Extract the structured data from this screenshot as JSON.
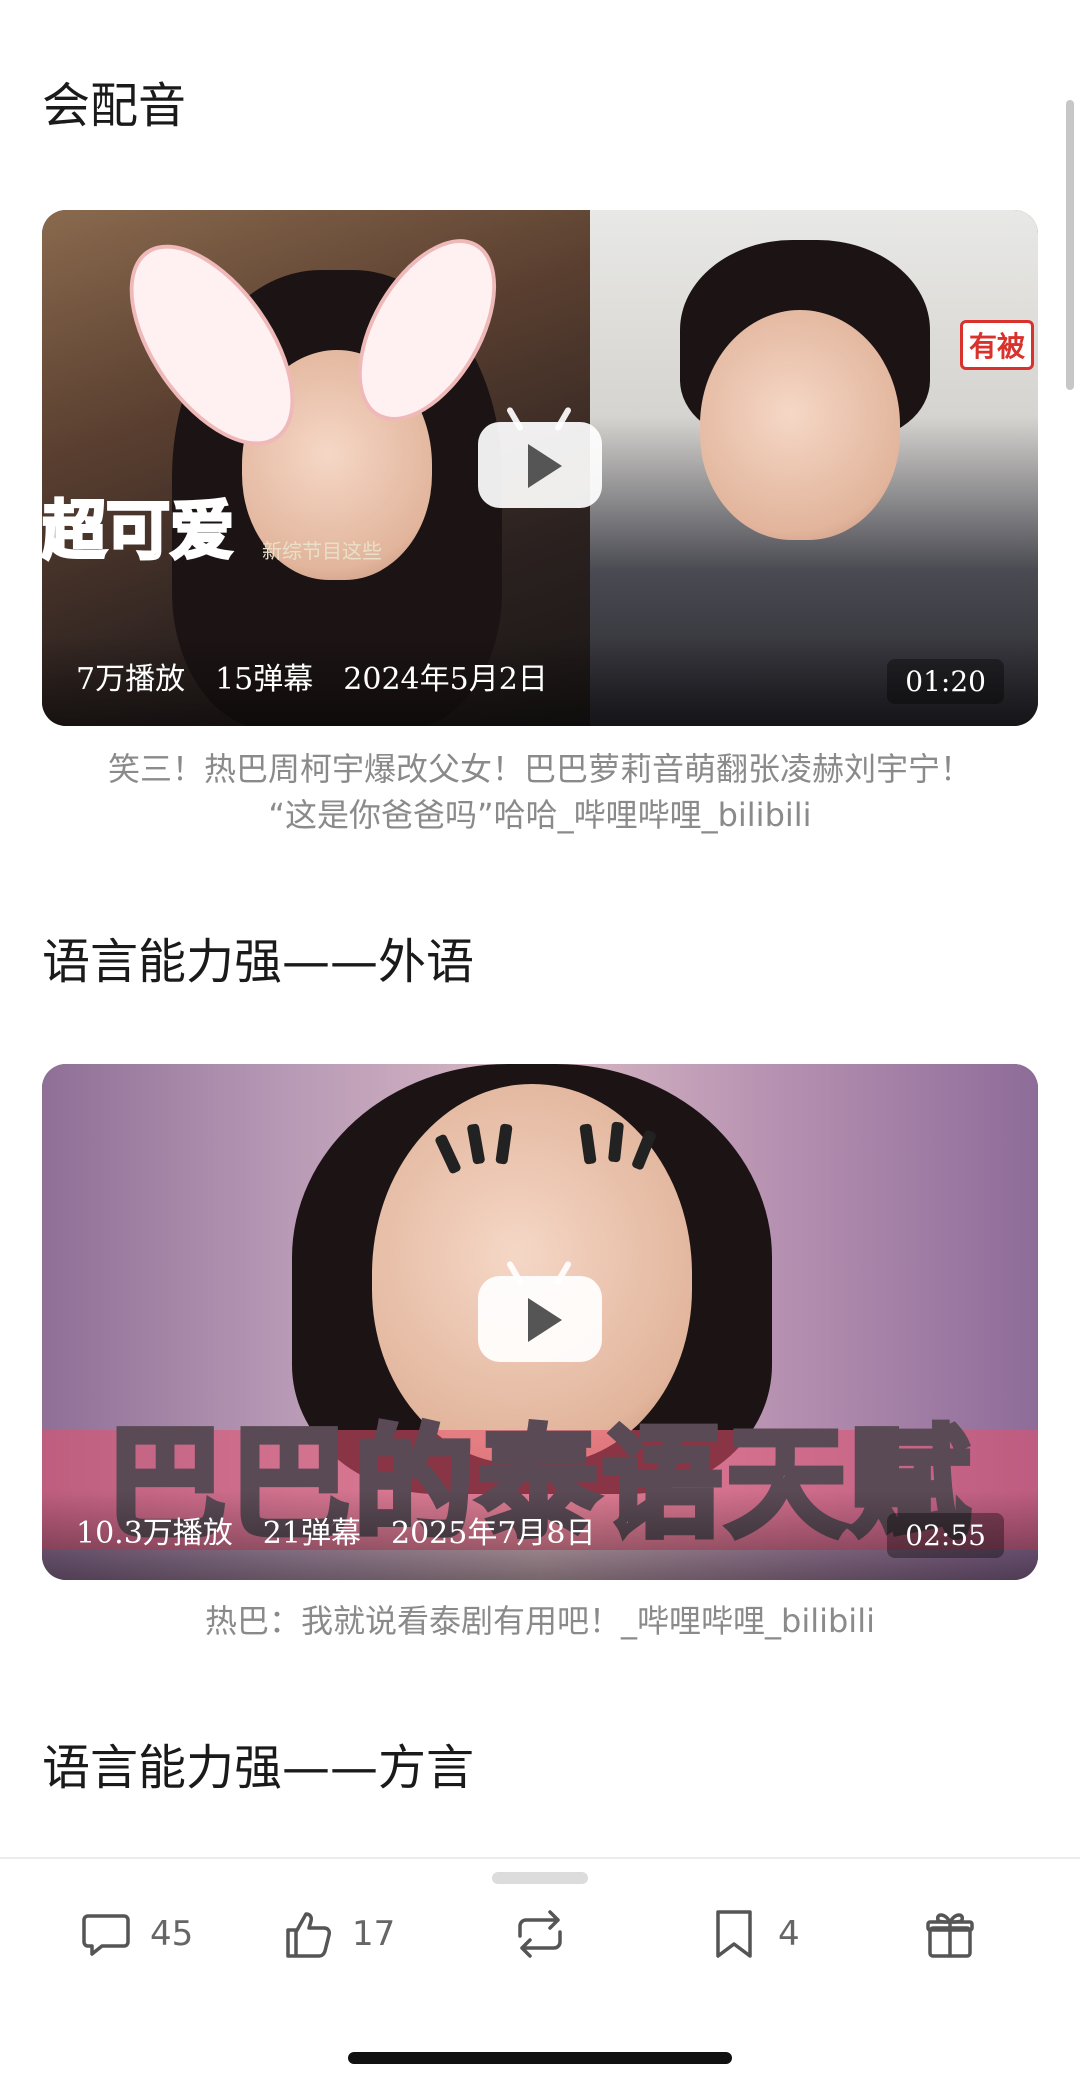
{
  "sections": [
    {
      "heading": "会配音"
    },
    {
      "heading": "语言能力强——外语"
    },
    {
      "heading": "语言能力强——方言"
    }
  ],
  "videos": [
    {
      "views": "7万播放",
      "danmaku": "15弹幕",
      "date": "2024年5月2日",
      "duration": "01:20",
      "caption_line1": "笑三！热巴周柯宇爆改父女！巴巴萝莉音萌翻张凌赫刘宇宁！",
      "caption_line2": "“这是你爸爸吗”哈哈_哔哩哔哩_bilibili",
      "sticker": "超可爱",
      "badge": "有被",
      "subtitle": "新综节目这些"
    },
    {
      "views": "10.3万播放",
      "danmaku": "21弹幕",
      "date": "2025年7月8日",
      "duration": "02:55",
      "caption_line1": "热巴：我就说看泰剧有用吧！_哔哩哔哩_bilibili",
      "banner": "巴巴的泰语天赋"
    }
  ],
  "actions": {
    "comment": {
      "icon": "comment-icon",
      "count": "45"
    },
    "like": {
      "icon": "thumbs-up-icon",
      "count": "17"
    },
    "repost": {
      "icon": "repost-icon"
    },
    "favorite": {
      "icon": "bookmark-icon",
      "count": "4"
    },
    "gift": {
      "icon": "gift-icon"
    }
  },
  "colors": {
    "caption": "#8a8a8a",
    "icon": "#555555"
  }
}
